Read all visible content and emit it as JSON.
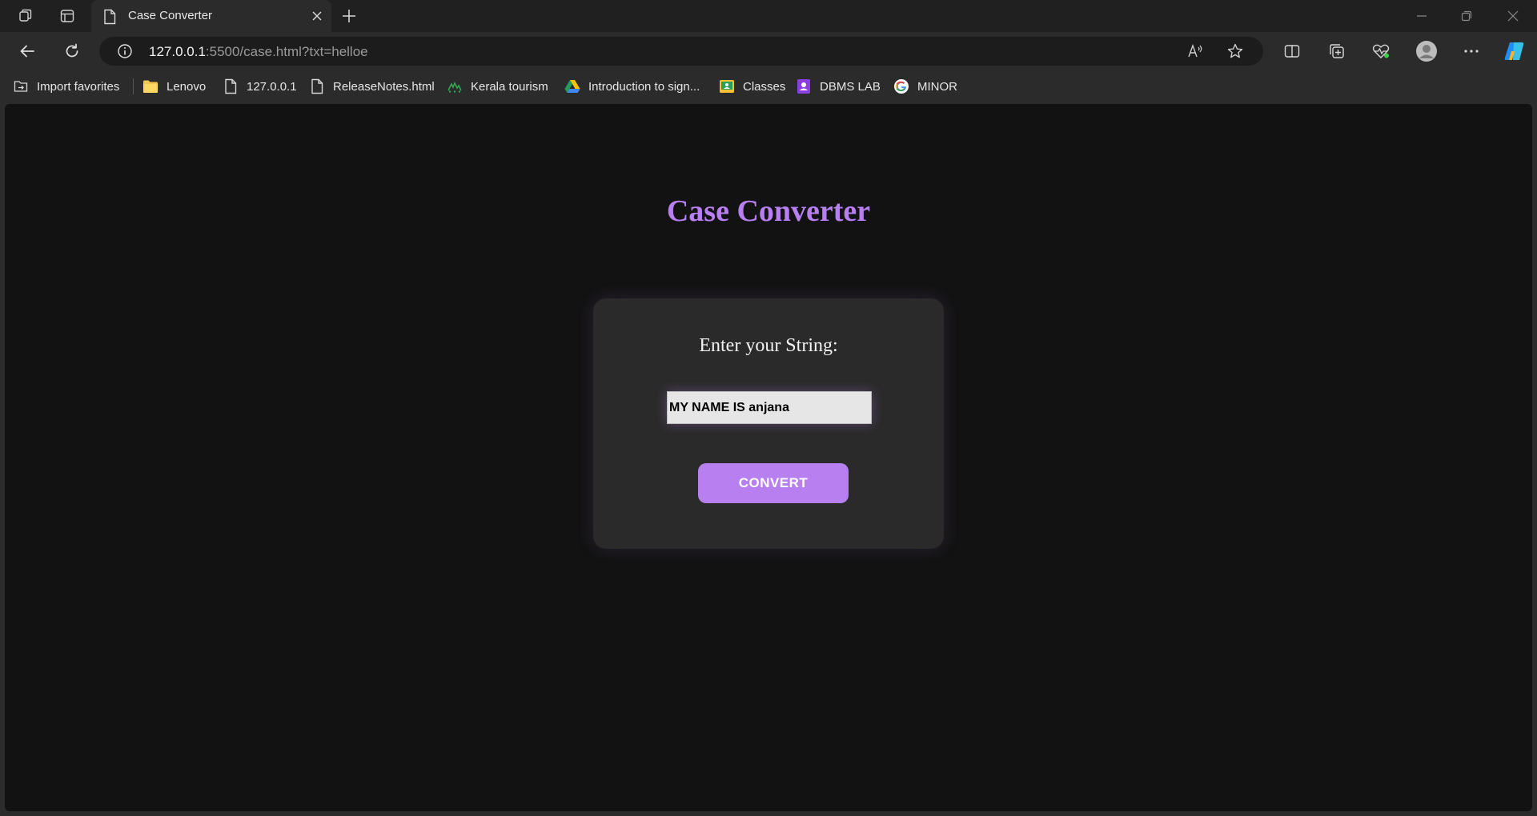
{
  "browser": {
    "tab": {
      "title": "Case Converter"
    },
    "address": {
      "host": "127.0.0.1",
      "rest": ":5500/case.html?txt=helloe"
    },
    "favorites": [
      {
        "label": "Import favorites",
        "icon": "import-favorites-icon"
      },
      {
        "label": "Lenovo",
        "icon": "folder-icon"
      },
      {
        "label": "127.0.0.1",
        "icon": "page-icon"
      },
      {
        "label": "ReleaseNotes.html",
        "icon": "page-icon"
      },
      {
        "label": "Kerala tourism",
        "icon": "kerala-tourism-icon"
      },
      {
        "label": "Introduction to sign...",
        "icon": "google-drive-icon"
      },
      {
        "label": "Classes",
        "icon": "classroom-icon"
      },
      {
        "label": "DBMS LAB",
        "icon": "contact-icon"
      },
      {
        "label": "MINOR",
        "icon": "google-icon"
      }
    ]
  },
  "page": {
    "title": "Case Converter",
    "input_label": "Enter your String:",
    "input_value": "MY NAME IS anjana",
    "button_label": "CONVERT"
  },
  "colors": {
    "accent": "#b77ff0",
    "page_bg": "#121212",
    "card_bg": "#2a2a2a"
  }
}
